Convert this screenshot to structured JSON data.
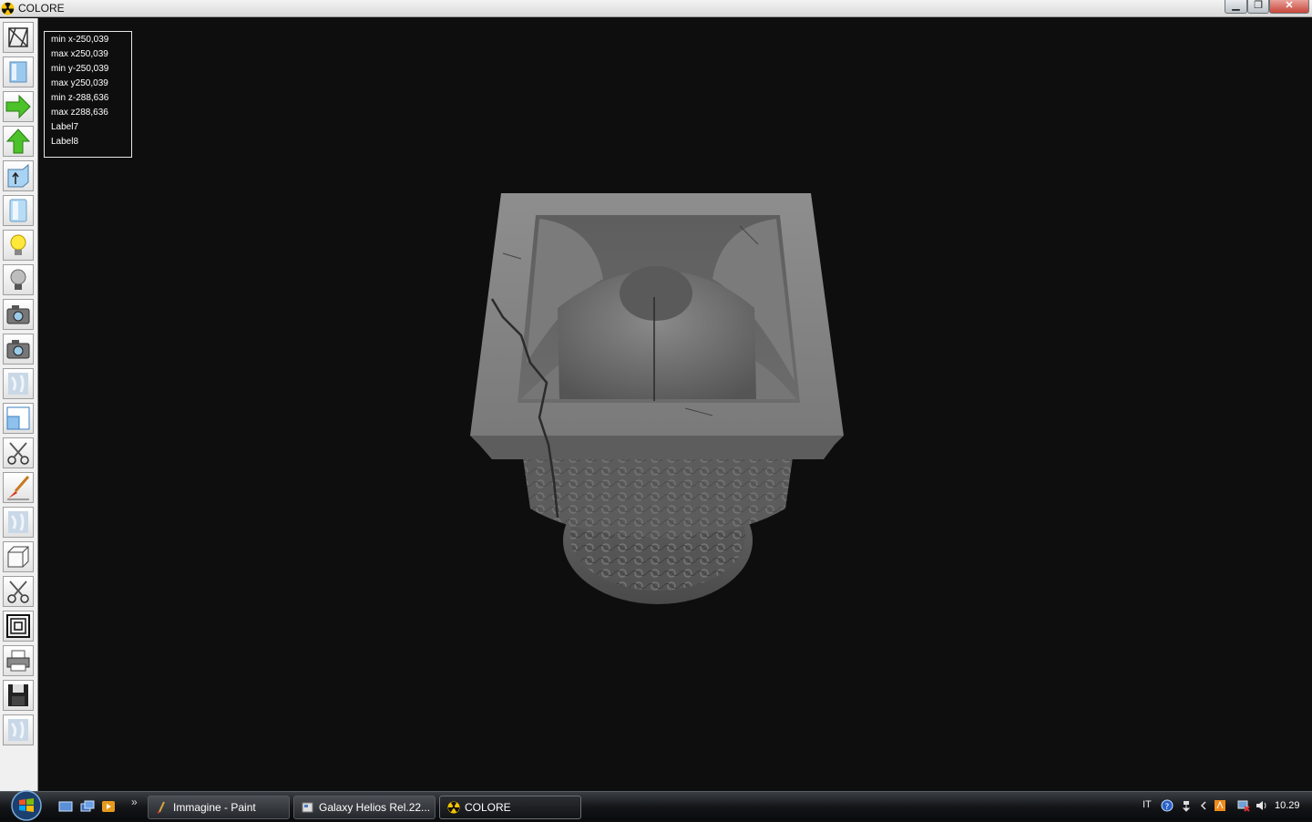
{
  "window": {
    "title": "COLORE",
    "minimize_label": "▁",
    "maximize_label": "❐",
    "close_label": "✕"
  },
  "toolbar": {
    "tools": [
      {
        "icon": "wireframe-icon"
      },
      {
        "icon": "solid-box-icon"
      },
      {
        "icon": "arrow-right-icon"
      },
      {
        "icon": "arrow-up-icon"
      },
      {
        "icon": "extrude-icon"
      },
      {
        "icon": "cylinder-icon"
      },
      {
        "icon": "light-on-icon"
      },
      {
        "icon": "light-off-icon"
      },
      {
        "icon": "camera-icon"
      },
      {
        "icon": "camera-icon-2"
      },
      {
        "icon": "texture-icon"
      },
      {
        "icon": "window-icon"
      },
      {
        "icon": "scissors-icon"
      },
      {
        "icon": "paint-brush-icon"
      },
      {
        "icon": "texture-icon-2"
      },
      {
        "icon": "cube-icon"
      },
      {
        "icon": "scissors-icon-2"
      },
      {
        "icon": "frame-icon"
      },
      {
        "icon": "printer-icon"
      },
      {
        "icon": "save-icon"
      },
      {
        "icon": "texture-icon-3"
      }
    ]
  },
  "info": {
    "min_x": "min x-250,039",
    "max_x": "max x250,039",
    "min_y": "min y-250,039",
    "max_y": "max y250,039",
    "min_z": "min z-288,636",
    "max_z": "max z288,636",
    "label7": "Label7",
    "label8": "Label8"
  },
  "taskbar": {
    "quicklaunch_more": "»",
    "tasks": [
      {
        "label": "Immagine - Paint"
      },
      {
        "label": "Galaxy Helios  Rel.22..."
      },
      {
        "label": "COLORE"
      }
    ],
    "tray": {
      "language": "IT",
      "clock": "10.29"
    }
  },
  "colors": {
    "viewport_bg": "#0e0e0e",
    "marble": "#8a8a8a"
  }
}
